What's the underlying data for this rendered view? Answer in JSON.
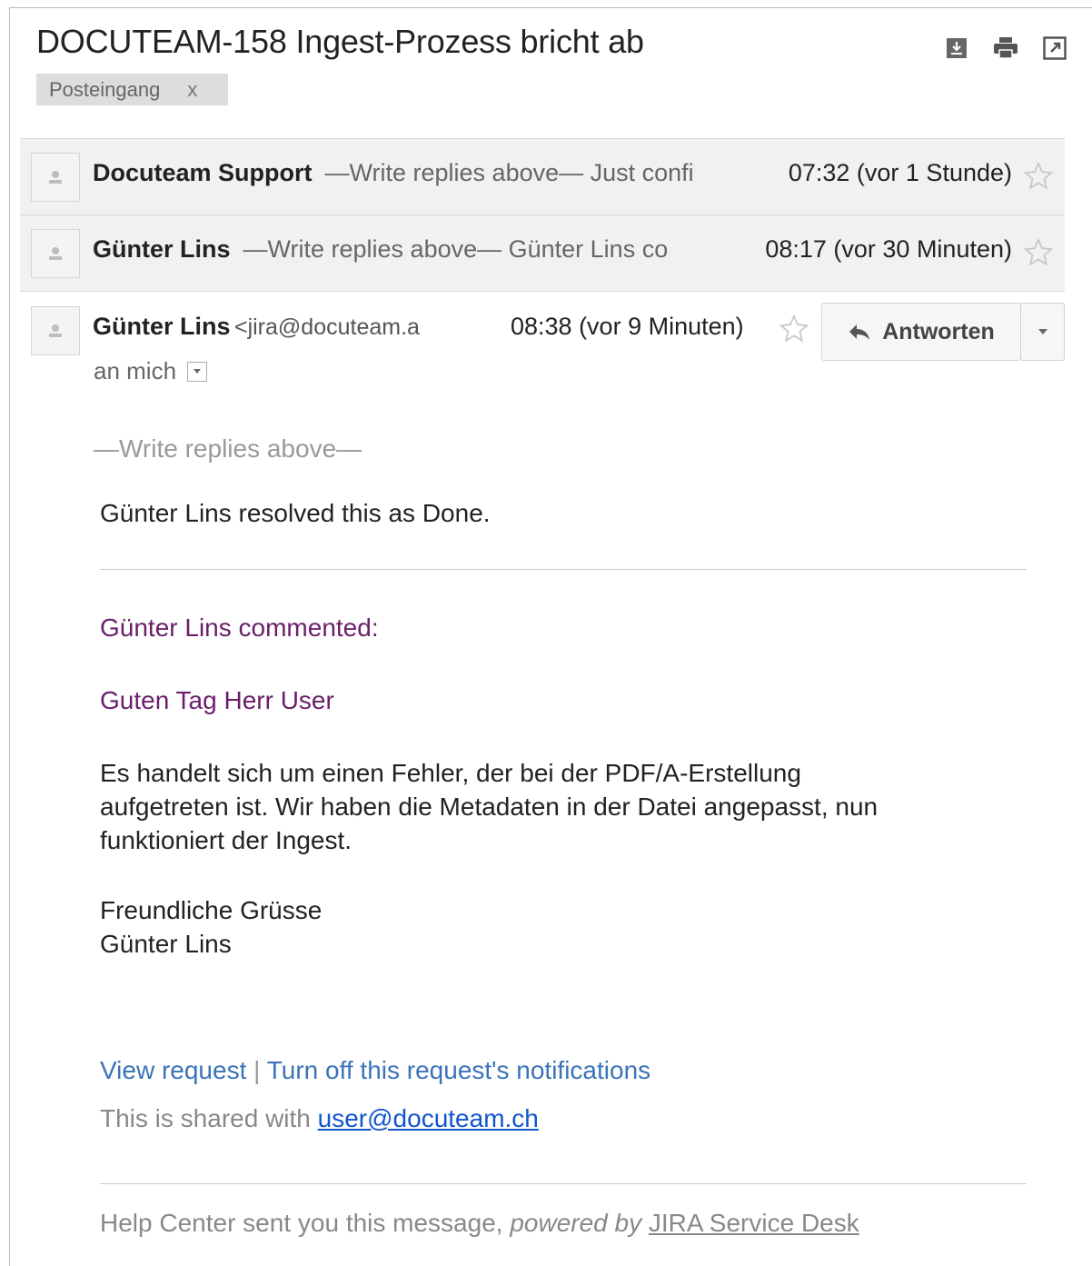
{
  "email": {
    "subject": "DOCUTEAM-158 Ingest-Prozess bricht ab",
    "label": "Posteingang",
    "label_remove": "x"
  },
  "icons": [
    "download-icon",
    "print-icon",
    "new-window-icon"
  ],
  "threads": [
    {
      "sender": "Docuteam Support",
      "snippet": "—Write replies above— Just confi",
      "time": "07:32 (vor 1 Stunde)"
    },
    {
      "sender": "Günter Lins",
      "snippet": "—Write replies above— Günter Lins co",
      "time": "08:17 (vor 30 Minuten)"
    }
  ],
  "message": {
    "sender": "Günter Lins",
    "sender_email": "<jira@docuteam.a",
    "time": "08:38 (vor 9 Minuten)",
    "to": "an mich",
    "reply_label": "Antworten",
    "write_above": "—Write replies above—",
    "resolved": "Günter Lins resolved this as Done.",
    "commented": "Günter Lins commented:",
    "greeting": "Guten Tag Herr User",
    "paragraph_lines": [
      "Es handelt sich um einen Fehler, der bei der PDF/A-Erstellung",
      "aufgetreten ist. Wir haben die Metadaten in der Datei angepasst, nun",
      "funktioniert der Ingest."
    ],
    "closing": "Freundliche Grüsse",
    "signature": "Günter Lins",
    "view_request": "View request",
    "separator": "|",
    "turn_off": "Turn off this request's notifications",
    "shared_prefix": "This is shared with",
    "shared_email": "user@docuteam.ch",
    "footer_prefix": "Help Center sent you this message,",
    "footer_powered": "powered by",
    "footer_link": "JIRA Service Desk"
  }
}
